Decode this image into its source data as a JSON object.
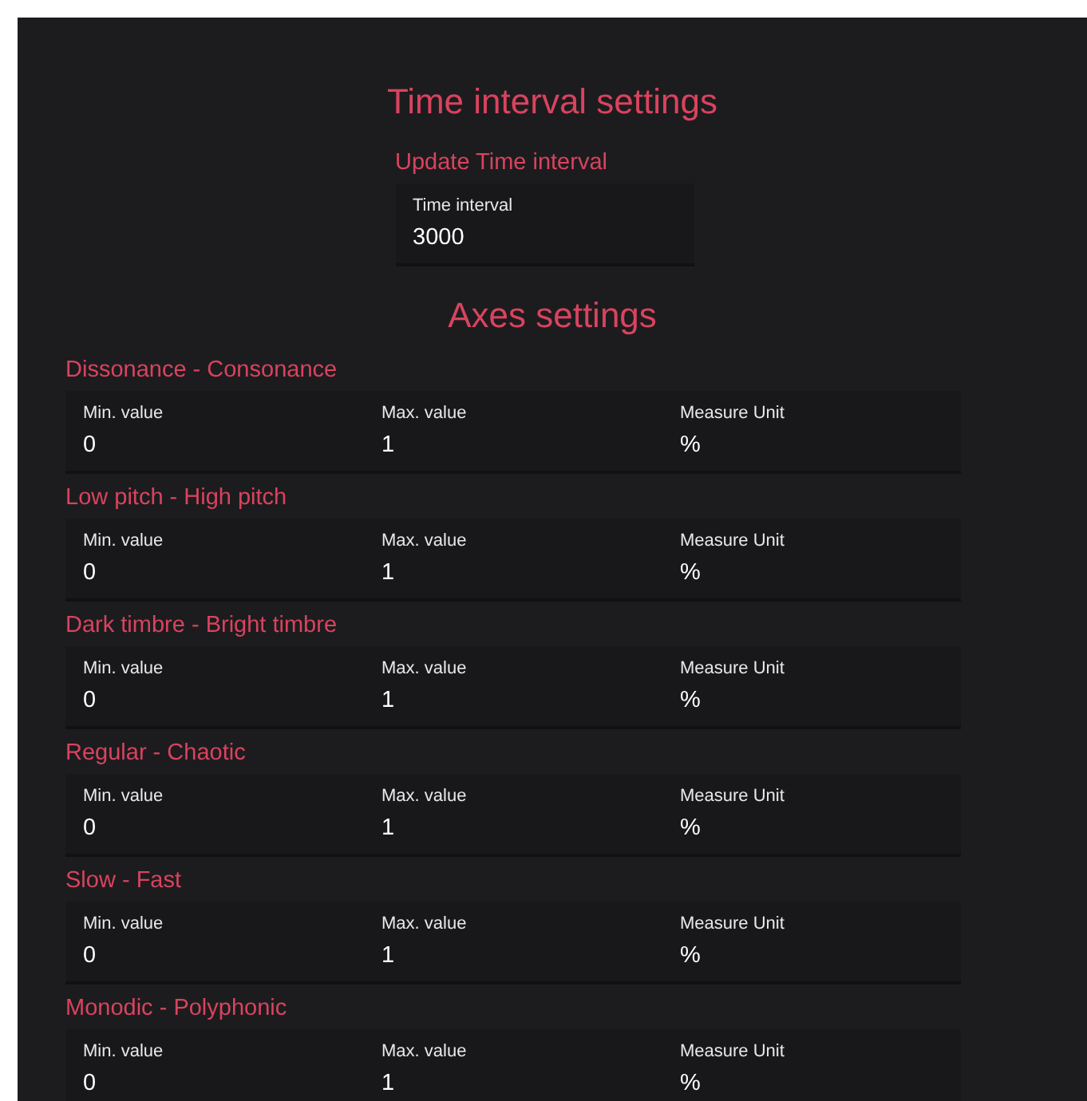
{
  "time_settings": {
    "title": "Time interval settings",
    "subtitle": "Update Time interval",
    "field": {
      "label": "Time interval",
      "value": "3000"
    }
  },
  "axes_settings": {
    "title": "Axes settings",
    "axes": [
      {
        "name": "Dissonance - Consonance",
        "fields": [
          {
            "label": "Min. value",
            "value": "0"
          },
          {
            "label": "Max. value",
            "value": "1"
          },
          {
            "label": "Measure Unit",
            "value": "%"
          }
        ]
      },
      {
        "name": "Low pitch - High pitch",
        "fields": [
          {
            "label": "Min. value",
            "value": "0"
          },
          {
            "label": "Max. value",
            "value": "1"
          },
          {
            "label": "Measure Unit",
            "value": "%"
          }
        ]
      },
      {
        "name": "Dark timbre - Bright timbre",
        "fields": [
          {
            "label": "Min. value",
            "value": "0"
          },
          {
            "label": "Max. value",
            "value": "1"
          },
          {
            "label": "Measure Unit",
            "value": "%"
          }
        ]
      },
      {
        "name": "Regular - Chaotic",
        "fields": [
          {
            "label": "Min. value",
            "value": "0"
          },
          {
            "label": "Max. value",
            "value": "1"
          },
          {
            "label": "Measure Unit",
            "value": "%"
          }
        ]
      },
      {
        "name": "Slow - Fast",
        "fields": [
          {
            "label": "Min. value",
            "value": "0"
          },
          {
            "label": "Max. value",
            "value": "1"
          },
          {
            "label": "Measure Unit",
            "value": "%"
          }
        ]
      },
      {
        "name": "Monodic - Polyphonic",
        "fields": [
          {
            "label": "Min. value",
            "value": "0"
          },
          {
            "label": "Max. value",
            "value": "1"
          },
          {
            "label": "Measure Unit",
            "value": "%"
          }
        ]
      }
    ]
  }
}
